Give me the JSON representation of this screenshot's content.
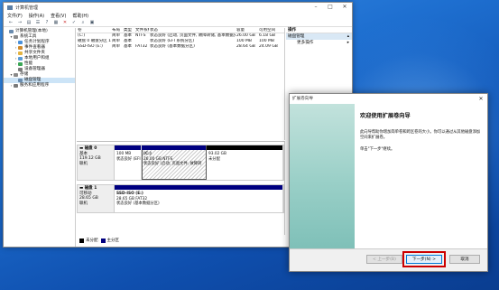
{
  "window": {
    "title": "计算机管理",
    "menus": [
      "文件(F)",
      "操作(A)",
      "查看(V)",
      "帮助(H)"
    ]
  },
  "tree": [
    {
      "label": "计算机管理(本地)",
      "indent": 0,
      "twisty": "",
      "color": "#6a8caf"
    },
    {
      "label": "系统工具",
      "indent": 1,
      "twisty": "▾",
      "color": "#8a8a8a"
    },
    {
      "label": "任务计划程序",
      "indent": 2,
      "twisty": "›",
      "color": "#4a90d9"
    },
    {
      "label": "事件查看器",
      "indent": 2,
      "twisty": "›",
      "color": "#d08a2a"
    },
    {
      "label": "共享文件夹",
      "indent": 2,
      "twisty": "›",
      "color": "#e3b341"
    },
    {
      "label": "本地用户和组",
      "indent": 2,
      "twisty": "›",
      "color": "#5a9bd6"
    },
    {
      "label": "性能",
      "indent": 2,
      "twisty": "›",
      "color": "#3aa655"
    },
    {
      "label": "设备管理器",
      "indent": 2,
      "twisty": "",
      "color": "#7a7a7a"
    },
    {
      "label": "存储",
      "indent": 1,
      "twisty": "▾",
      "color": "#8a8a8a"
    },
    {
      "label": "磁盘管理",
      "indent": 2,
      "twisty": "",
      "color": "#6a8caf",
      "selected": true
    },
    {
      "label": "服务和应用程序",
      "indent": 1,
      "twisty": "›",
      "color": "#7a7a7a"
    }
  ],
  "volumes": {
    "headers": [
      "卷",
      "布局",
      "类型",
      "文件系统",
      "状态",
      "容量",
      "可用空间"
    ],
    "rows": [
      [
        "(C:)",
        "简单",
        "基本",
        "NTFS",
        "状态良好 (启动, 页面文件, 故障转储, 基本数据分区)",
        "26.00 GB",
        "6.18 GB"
      ],
      [
        "磁盘 0 磁盘分区 1",
        "简单",
        "基本",
        "",
        "状态良好 (EFI 系统分区)",
        "100 MB",
        "100 MB"
      ],
      [
        "SSD-ISO (E:)",
        "简单",
        "基本",
        "FAT32",
        "状态良好 (基本数据分区)",
        "28.64 GB",
        "24.09 GB"
      ]
    ]
  },
  "disks": [
    {
      "name": "磁盘 0",
      "lines": [
        "基本",
        "119.12 GB",
        "联机"
      ],
      "partitions": [
        {
          "title": "",
          "lines": [
            "100 MB",
            "状态良好 (EFI"
          ],
          "bar": "#000080",
          "hatch": false
        },
        {
          "title": "(C:)",
          "lines": [
            "26.00 GB NTFS",
            "状态良好 (启动, 页面文件, 故障转"
          ],
          "bar": "#000080",
          "hatch": true
        },
        {
          "title": "",
          "lines": [
            "93.02 GB",
            "未分配"
          ],
          "bar": "#000000",
          "hatch": false
        }
      ]
    },
    {
      "name": "磁盘 1",
      "lines": [
        "可移动",
        "28.65 GB",
        "联机"
      ],
      "partitions": [
        {
          "title": "SSD-ISO (E:)",
          "lines": [
            "28.65 GB FAT32",
            "状态良好 (基本数据分区)"
          ],
          "bar": "#000080",
          "hatch": false
        }
      ]
    }
  ],
  "legend": [
    {
      "label": "未分配",
      "color": "#000000"
    },
    {
      "label": "主分区",
      "color": "#000080"
    }
  ],
  "actions": {
    "header": "操作",
    "section": "磁盘管理",
    "more": "更多操作"
  },
  "wizard": {
    "title": "扩展卷向导",
    "heading": "欢迎使用扩展卷向导",
    "para1": "此向导帮助你增加简单卷和跨区卷的大小。你可以通过从其他磁盘添加空间来扩展卷。",
    "para2": "单击\"下一步\"继续。",
    "back": "< 上一步(B)",
    "next": "下一步(N) >",
    "cancel": "取消"
  }
}
